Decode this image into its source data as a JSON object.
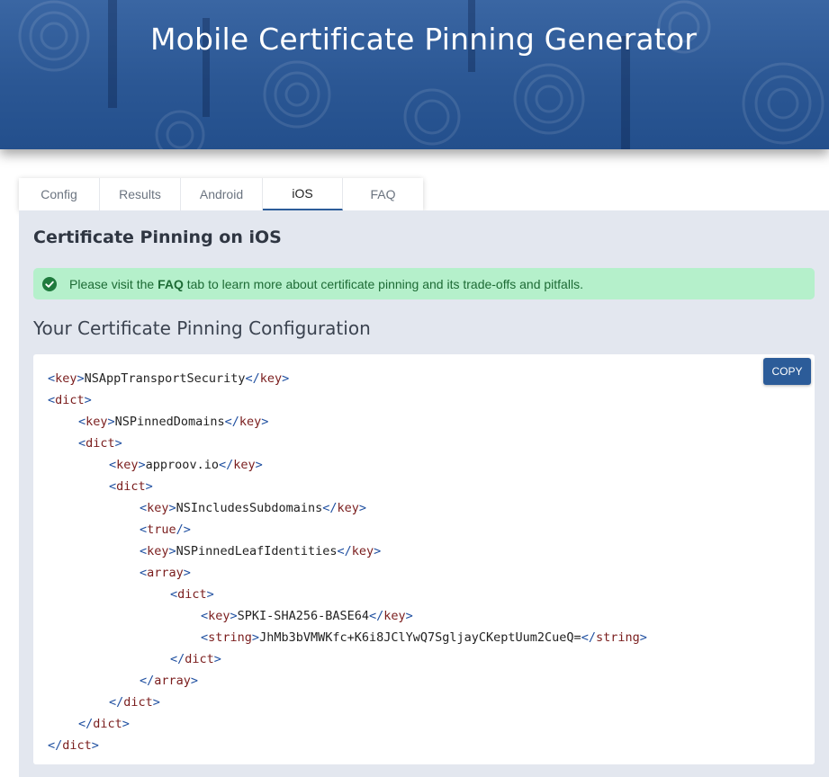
{
  "header": {
    "title": "Mobile Certificate Pinning Generator"
  },
  "tabs": [
    {
      "label": "Config",
      "active": false
    },
    {
      "label": "Results",
      "active": false
    },
    {
      "label": "Android",
      "active": false
    },
    {
      "label": "iOS",
      "active": true
    },
    {
      "label": "FAQ",
      "active": false
    }
  ],
  "main": {
    "title": "Certificate Pinning on iOS",
    "alert": {
      "icon": "check-circle-icon",
      "prefix": "Please visit the",
      "link": "FAQ",
      "suffix": "tab to learn more about certificate pinning and its trade-offs and pitfalls."
    },
    "config_title": "Your Certificate Pinning Configuration",
    "copy_label": "COPY",
    "code_lines": [
      {
        "indent": 0,
        "tag": "key",
        "text": "NSAppTransportSecurity",
        "close": true
      },
      {
        "indent": 0,
        "tag": "dict",
        "text": "",
        "close": false
      },
      {
        "indent": 1,
        "tag": "key",
        "text": "NSPinnedDomains",
        "close": true
      },
      {
        "indent": 1,
        "tag": "dict",
        "text": "",
        "close": false
      },
      {
        "indent": 2,
        "tag": "key",
        "text": "approov.io",
        "close": true
      },
      {
        "indent": 2,
        "tag": "dict",
        "text": "",
        "close": false
      },
      {
        "indent": 3,
        "tag": "key",
        "text": "NSIncludesSubdomains",
        "close": true
      },
      {
        "indent": 3,
        "tag": "true",
        "text": "",
        "self_close": true
      },
      {
        "indent": 3,
        "tag": "key",
        "text": "NSPinnedLeafIdentities",
        "close": true
      },
      {
        "indent": 3,
        "tag": "array",
        "text": "",
        "close": false
      },
      {
        "indent": 4,
        "tag": "dict",
        "text": "",
        "close": false
      },
      {
        "indent": 5,
        "tag": "key",
        "text": "SPKI-SHA256-BASE64",
        "close": true
      },
      {
        "indent": 5,
        "tag": "string",
        "text": "JhMb3bVMWKfc+K6i8JClYwQ7SgljayCKeptUum2CueQ=",
        "close": true
      },
      {
        "indent": 4,
        "tag": "/dict",
        "text": "",
        "close": false
      },
      {
        "indent": 3,
        "tag": "/array",
        "text": "",
        "close": false
      },
      {
        "indent": 2,
        "tag": "/dict",
        "text": "",
        "close": false
      },
      {
        "indent": 1,
        "tag": "/dict",
        "text": "",
        "close": false
      },
      {
        "indent": 0,
        "tag": "/dict",
        "text": "",
        "close": false
      }
    ]
  },
  "colors": {
    "header_bg": "#2b5794",
    "accent": "#2c5c99",
    "panel_bg": "#e3e7ef",
    "alert_bg": "#b5f0cb",
    "alert_text": "#1d6b35",
    "xml_tag": "#7a1d1d",
    "xml_bracket": "#1f4fa0"
  }
}
